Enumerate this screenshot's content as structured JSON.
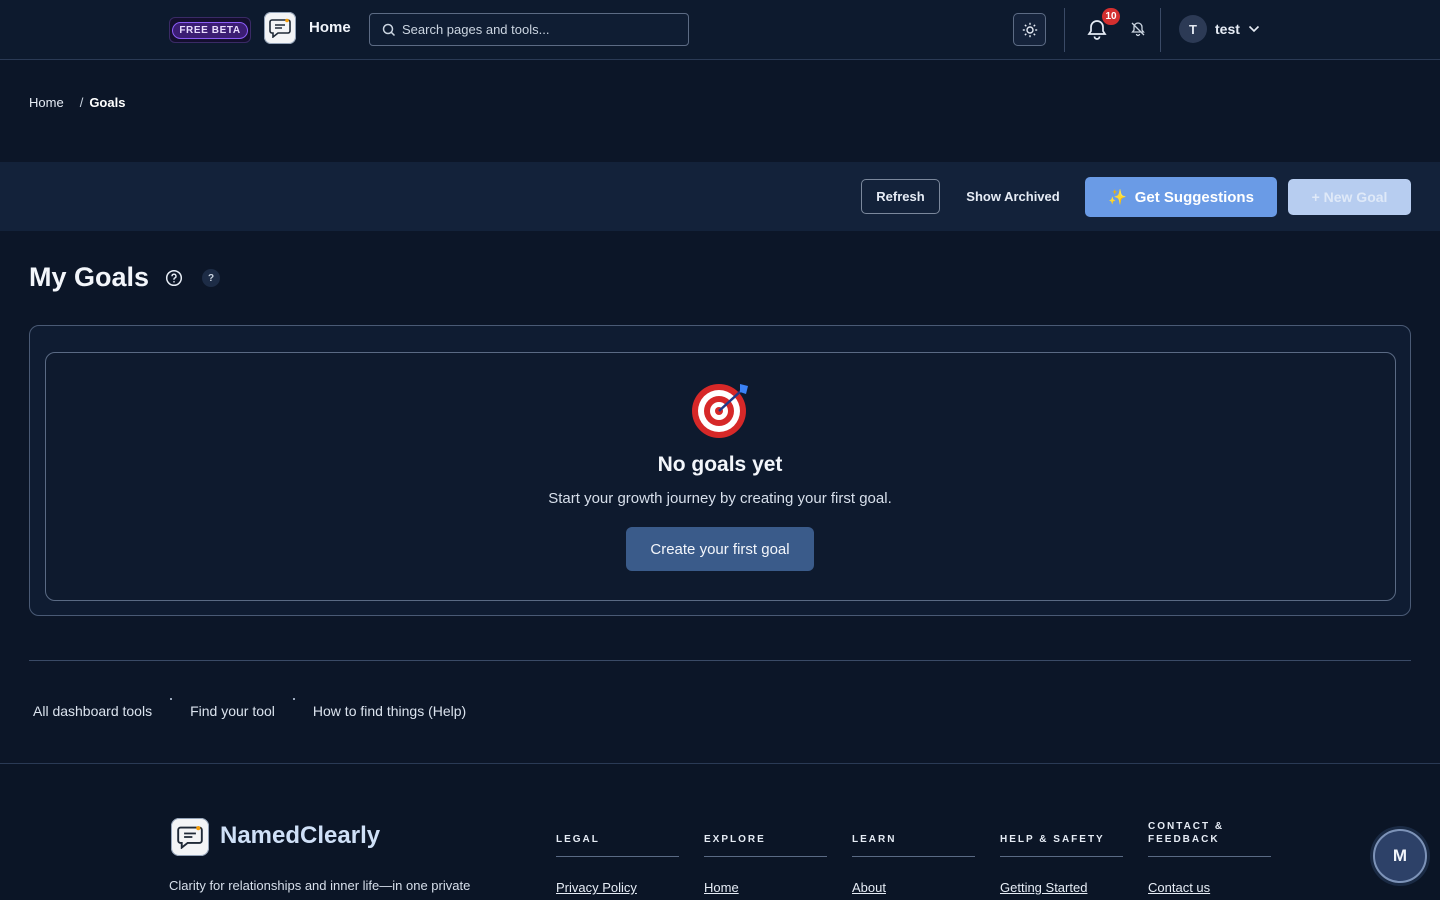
{
  "topbar": {
    "beta_badge": "FREE BETA",
    "home_label": "Home",
    "search_placeholder": "Search pages and tools...",
    "notification_count": "10",
    "user_initial": "T",
    "user_name": "test"
  },
  "breadcrumb": {
    "home": "Home",
    "separator": "/",
    "current": "Goals"
  },
  "actions": {
    "refresh": "Refresh",
    "show_archived": "Show Archived",
    "suggestions_emoji": "✨",
    "suggestions": "Get Suggestions",
    "new_goal": "+ New Goal"
  },
  "page": {
    "title": "My Goals",
    "help_badge": "?"
  },
  "empty_state": {
    "title": "No goals yet",
    "subtitle": "Start your growth journey by creating your first goal.",
    "cta": "Create your first goal"
  },
  "quick_links": [
    "All dashboard tools",
    "Find your tool",
    "How to find things (Help)"
  ],
  "footer": {
    "brand": "NamedClearly",
    "tagline": "Clarity for relationships and inner life—in one private",
    "columns": [
      {
        "heading": "LEGAL",
        "link": "Privacy Policy"
      },
      {
        "heading": "EXPLORE",
        "link": "Home"
      },
      {
        "heading": "LEARN",
        "link": "About"
      },
      {
        "heading": "HELP & SAFETY",
        "link": "Getting Started"
      },
      {
        "heading": "CONTACT & FEEDBACK",
        "link": "Contact us"
      }
    ],
    "fab_initial": "M"
  },
  "colors": {
    "background": "#0c1628",
    "accent": "#6a9be6",
    "cta": "#3a5b8a",
    "badge_red": "#d32f2f"
  },
  "icons": [
    "app-logo-icon",
    "search-icon",
    "sun-icon",
    "bell-icon",
    "bell-off-icon",
    "chevron-down-icon",
    "help-circle-icon",
    "target-icon"
  ]
}
